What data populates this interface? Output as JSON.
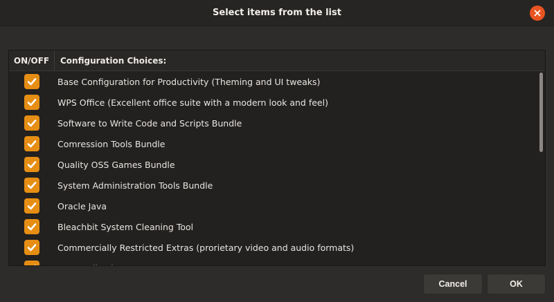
{
  "window": {
    "title": "Select items from the list",
    "close_icon": "close-icon",
    "accent_color": "#e95420"
  },
  "list": {
    "columns": [
      "ON/OFF",
      "Configuration Choices:"
    ],
    "checkbox_color": "#e68e14",
    "items": [
      {
        "checked": true,
        "label": "Base Configuration for Productivity (Theming and UI tweaks)"
      },
      {
        "checked": true,
        "label": "WPS Office (Excellent office suite with a modern look and feel)"
      },
      {
        "checked": true,
        "label": "Software to Write Code and Scripts Bundle"
      },
      {
        "checked": true,
        "label": "Comression Tools Bundle"
      },
      {
        "checked": true,
        "label": "Quality OSS Games Bundle"
      },
      {
        "checked": true,
        "label": "System Administration Tools Bundle"
      },
      {
        "checked": true,
        "label": "Oracle Java"
      },
      {
        "checked": true,
        "label": "Bleachbit System Cleaning Tool"
      },
      {
        "checked": true,
        "label": "Commercially Restricted Extras (prorietary video and audio formats)"
      },
      {
        "checked": true,
        "label": "VLC Media Player"
      }
    ]
  },
  "buttons": {
    "cancel": "Cancel",
    "ok": "OK"
  }
}
